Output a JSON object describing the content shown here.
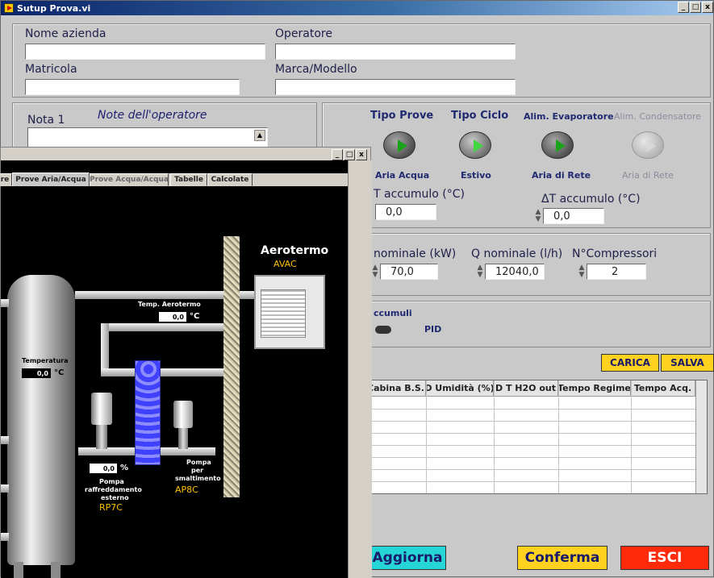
{
  "main_window": {
    "title": "Sutup Prova.vi",
    "min": "_",
    "max": "□",
    "close": "x"
  },
  "form": {
    "company_label": "Nome azienda",
    "operator_label": "Operatore",
    "serial_label": "Matricola",
    "brand_label": "Marca/Modello",
    "note_label": "Nota 1",
    "note_caption": "Note dell'operatore"
  },
  "controls": {
    "test_type": {
      "title": "Tipo Prove",
      "value": "Aria Acqua"
    },
    "cycle_type": {
      "title": "Tipo Ciclo",
      "value": "Estivo"
    },
    "evap_supply": {
      "title": "Alim. Evaporatore",
      "value": "Aria di Rete"
    },
    "cond_supply": {
      "title": "Alim. Condensatore",
      "value": "Aria di Rete"
    }
  },
  "accum": {
    "label1": "T accumulo (°C)",
    "value1": "0,0",
    "label2": "ΔT accumulo (°C)",
    "value2": "0,0"
  },
  "nominal": {
    "power_label": "nominale (kW)",
    "power_value": "70,0",
    "flow_label": "Q nominale (l/h)",
    "flow_value": "12040,0",
    "comp_label": "N°Compressori",
    "comp_value": "2"
  },
  "accumuli": {
    "label": "ccumuli",
    "pid": "PID"
  },
  "buttons": {
    "carica": "CARICA",
    "salva": "SALVA",
    "aggiorna": "Aggiorna",
    "conferma": "Conferma",
    "esci": "ESCI"
  },
  "table": {
    "headers": [
      "Cabina B.S.",
      "D Umidità (%)",
      "D T H2O out",
      "Tempo Regime",
      "Tempo Acq."
    ]
  },
  "inner_window": {
    "tabs": [
      "re",
      "Prove Aria/Acqua",
      "Prove Acqua/Acqua",
      "Tabelle",
      "Calcolate"
    ],
    "aerotermo_title": "Aerotermo",
    "aerotermo_sub": "AVAC",
    "temp_aero_label": "Temp. Aerotermo",
    "temp_aero_value": "0,0",
    "temp_aero_unit": "°C",
    "temperatura_label": "Temperatura",
    "temperatura_value": "0,0",
    "temperatura_unit": "°C",
    "pump1_value": "0,0",
    "pump1_unit": "%",
    "pump1_label1": "Pompa",
    "pump1_label2": "raffreddamento",
    "pump1_label3": "esterno",
    "pump1_code": "RP7C",
    "pump2_label1": "Pompa",
    "pump2_label2": "per",
    "pump2_label3": "smaltimento",
    "pump2_code": "AP8C"
  }
}
